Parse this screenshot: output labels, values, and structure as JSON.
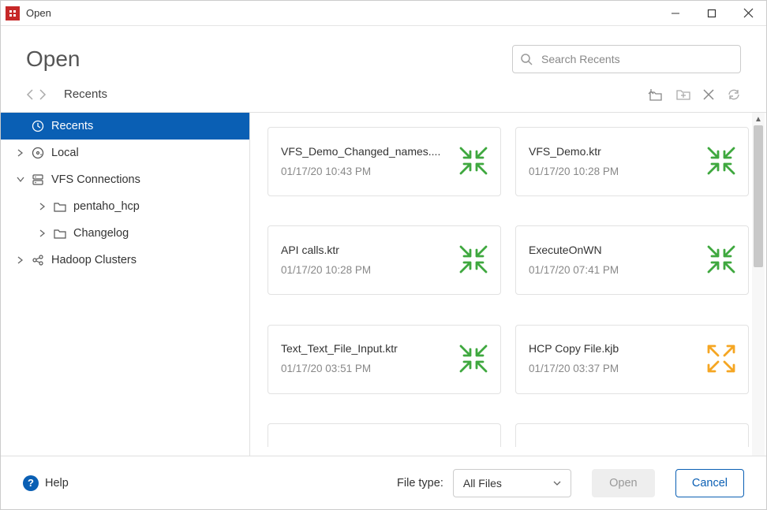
{
  "window": {
    "title": "Open"
  },
  "header": {
    "title": "Open",
    "search_placeholder": "Search Recents"
  },
  "nav": {
    "breadcrumb": "Recents"
  },
  "sidebar": {
    "items": [
      {
        "label": "Recents",
        "icon": "clock",
        "selected": true
      },
      {
        "label": "Local",
        "icon": "disk",
        "expandable": true,
        "expanded": false
      },
      {
        "label": "VFS Connections",
        "icon": "server",
        "expandable": true,
        "expanded": true,
        "children": [
          {
            "label": "pentaho_hcp",
            "icon": "folder",
            "expandable": true
          },
          {
            "label": "Changelog",
            "icon": "folder",
            "expandable": true
          }
        ]
      },
      {
        "label": "Hadoop Clusters",
        "icon": "share",
        "expandable": true,
        "expanded": false
      }
    ]
  },
  "files": [
    {
      "name": "VFS_Demo_Changed_names....",
      "date": "01/17/20 10:43 PM",
      "type": "ktr"
    },
    {
      "name": "VFS_Demo.ktr",
      "date": "01/17/20 10:28 PM",
      "type": "ktr"
    },
    {
      "name": "API calls.ktr",
      "date": "01/17/20 10:28 PM",
      "type": "ktr"
    },
    {
      "name": "ExecuteOnWN",
      "date": "01/17/20 07:41 PM",
      "type": "ktr"
    },
    {
      "name": "Text_Text_File_Input.ktr",
      "date": "01/17/20 03:51 PM",
      "type": "ktr"
    },
    {
      "name": "HCP Copy File.kjb",
      "date": "01/17/20 03:37 PM",
      "type": "kjb"
    }
  ],
  "footer": {
    "help_label": "Help",
    "file_type_label": "File type:",
    "file_type_value": "All Files",
    "open_label": "Open",
    "cancel_label": "Cancel"
  },
  "colors": {
    "accent": "#0a5fb4",
    "ktr_icon": "#3fa83f",
    "kjb_icon": "#f5a623"
  }
}
